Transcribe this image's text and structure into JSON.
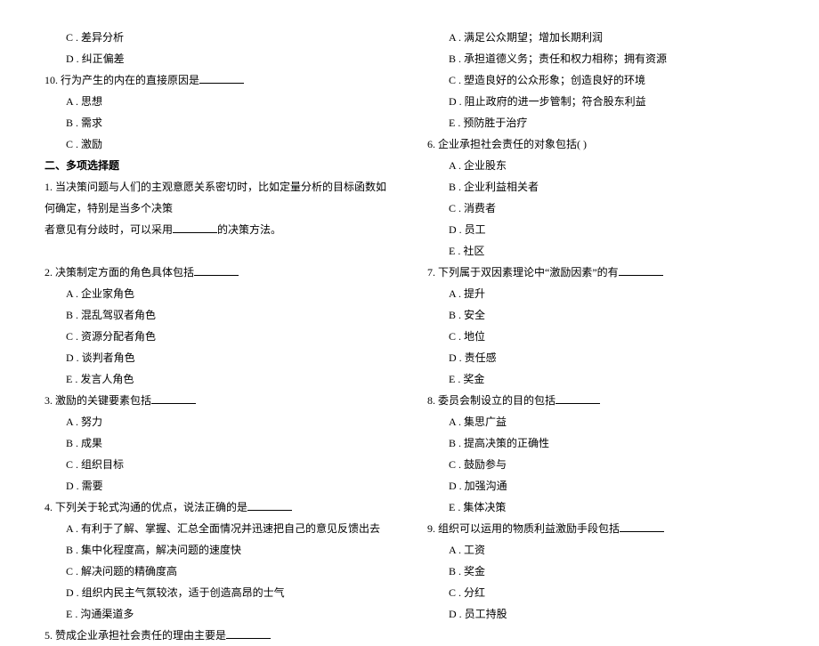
{
  "left": {
    "q_c": "C . 差异分析",
    "q_d": "D . 纠正偏差",
    "q10_stem": "10. 行为产生的内在的直接原因是",
    "q10_a": "A . 思想",
    "q10_b": "B . 需求",
    "q10_c": "C . 激励",
    "section2": "二、多项选择题",
    "q1_stem_1": "1. 当决策问题与人们的主观意愿关系密切时，比如定量分析的目标函数如何确定，特别是当多个决策",
    "q1_stem_2a": "者意见有分歧时，可以采用",
    "q1_stem_2b": "的决策方法。",
    "q2_stem": "2. 决策制定方面的角色具体包括",
    "q2_a": "A . 企业家角色",
    "q2_b": "B . 混乱驾驭者角色",
    "q2_c": "C . 资源分配者角色",
    "q2_d": "D . 谈判者角色",
    "q2_e": "E . 发言人角色",
    "q3_stem": "3. 激励的关键要素包括",
    "q3_a": "A . 努力",
    "q3_b": "B . 成果",
    "q3_c": "C . 组织目标",
    "q3_d": "D . 需要",
    "q4_stem": "4. 下列关于轮式沟通的优点，说法正确的是",
    "q4_a": "A . 有利于了解、掌握、汇总全面情况并迅速把自己的意见反馈出去",
    "q4_b": "B . 集中化程度高，解决问题的速度快",
    "q4_c": "C . 解决问题的精确度高",
    "q4_d": "D . 组织内民主气氛较浓，适于创造高昂的士气",
    "q4_e": "E . 沟通渠道多",
    "q5_stem": "5. 赞成企业承担社会责任的理由主要是"
  },
  "right": {
    "q5_a": "A . 满足公众期望；增加长期利润",
    "q5_b": "B . 承担道德义务；责任和权力相称；拥有资源",
    "q5_c": "C . 塑造良好的公众形象；创造良好的环境",
    "q5_d": "D . 阻止政府的进一步管制；符合股东利益",
    "q5_e": "E . 预防胜于治疗",
    "q6_stem": "6. 企业承担社会责任的对象包括( )",
    "q6_a": "A . 企业股东",
    "q6_b": "B . 企业利益相关者",
    "q6_c": "C . 消费者",
    "q6_d": "D . 员工",
    "q6_e": "E . 社区",
    "q7_stem": "7. 下列属于双因素理论中“激励因素”的有",
    "q7_a": "A . 提升",
    "q7_b": "B . 安全",
    "q7_c": "C . 地位",
    "q7_d": "D . 责任感",
    "q7_e": "E . 奖金",
    "q8_stem": "8. 委员会制设立的目的包括",
    "q8_a": "A . 集思广益",
    "q8_b": "B . 提高决策的正确性",
    "q8_c": "C . 鼓励参与",
    "q8_d": "D . 加强沟通",
    "q8_e": "E . 集体决策",
    "q9_stem": "9. 组织可以运用的物质利益激励手段包括",
    "q9_a": "A . 工资",
    "q9_b": "B . 奖金",
    "q9_c": "C . 分红",
    "q9_d": "D . 员工持股"
  }
}
